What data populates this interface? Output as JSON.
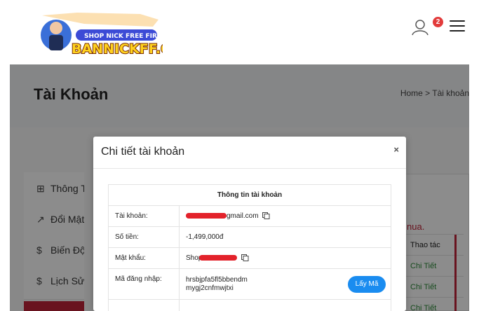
{
  "header": {
    "logo_small_text": "SHOP NICK FREE FIRE",
    "logo_big_text": "BANNICKFF.COM",
    "notification_count": "2"
  },
  "page": {
    "title": "Tài Khoản",
    "breadcrumb": "Home > Tài khoản"
  },
  "sidebar": {
    "items": [
      {
        "icon": "⊞",
        "label": "Thông Tin"
      },
      {
        "icon": "↗",
        "label": "Đổi Mật Khẩu"
      },
      {
        "icon": "$",
        "label": "Biến Động"
      },
      {
        "icon": "$",
        "label": "Lịch Sử"
      }
    ]
  },
  "background_table": {
    "note": "nua.",
    "header": "Thao tác",
    "links": [
      "Chi Tiết",
      "Chi Tiết",
      "Chi Tiết"
    ]
  },
  "modal": {
    "title": "Chi tiết tài khoản",
    "close": "×",
    "table_title": "Thông tin tài khoản",
    "rows": {
      "account_label": "Tài khoản:",
      "account_value_suffix": "gmail.com",
      "balance_label": "Số tiền:",
      "balance_value": "-1,499,000đ",
      "password_label": "Mật khẩu:",
      "password_value_prefix": "Shop",
      "login_code_label": "Mã đăng nhập:",
      "login_code_line1": "hrsbjpfa5fl5bbendm",
      "login_code_line2": "mygj2cnfmwjtxi",
      "get_code_button": "Lấy Mã"
    }
  },
  "colors": {
    "accent_blue": "#1a8cf0",
    "money_orange": "#f2a100",
    "brand_red": "#c0243a",
    "link_green": "#2e8b3a"
  }
}
